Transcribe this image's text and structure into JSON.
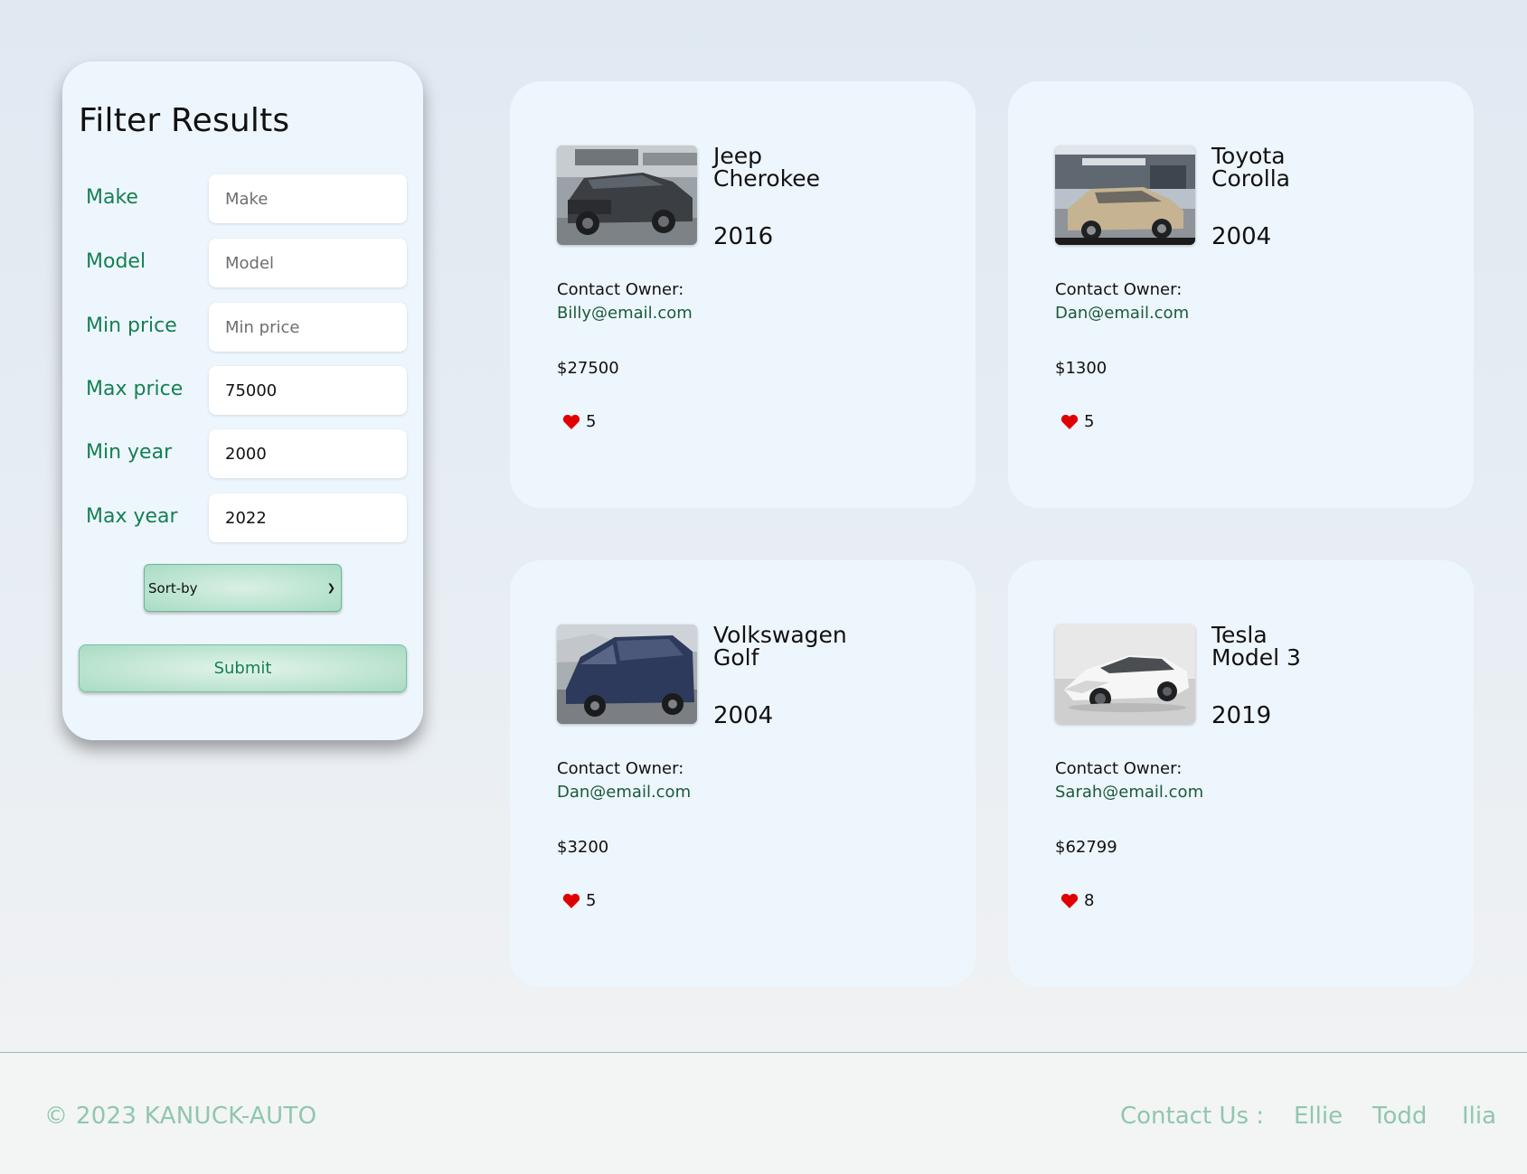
{
  "filter": {
    "title": "Filter Results",
    "fields": [
      {
        "label": "Make",
        "placeholder": "Make",
        "value": ""
      },
      {
        "label": "Model",
        "placeholder": "Model",
        "value": ""
      },
      {
        "label": "Min price",
        "placeholder": "Min price",
        "value": ""
      },
      {
        "label": "Max price",
        "placeholder": "Max price",
        "value": "75000"
      },
      {
        "label": "Min year",
        "placeholder": "Min year",
        "value": "2000"
      },
      {
        "label": "Max year",
        "placeholder": "Max year",
        "value": "2022"
      }
    ],
    "sort_selected": "Sort-by",
    "submit_label": "Submit"
  },
  "listings": [
    {
      "make": "Jeep",
      "model": "Cherokee",
      "year": "2016",
      "contact_label": "Contact Owner:",
      "email": "Billy@email.com",
      "price": "$27500",
      "likes": "5"
    },
    {
      "make": "Toyota",
      "model": "Corolla",
      "year": "2004",
      "contact_label": "Contact Owner:",
      "email": "Dan@email.com",
      "price": "$1300",
      "likes": "5"
    },
    {
      "make": "Volkswagen",
      "model": "Golf",
      "year": "2004",
      "contact_label": "Contact Owner:",
      "email": "Dan@email.com",
      "price": "$3200",
      "likes": "5"
    },
    {
      "make": "Tesla",
      "model": "Model 3",
      "year": "2019",
      "contact_label": "Contact Owner:",
      "email": "Sarah@email.com",
      "price": "$62799",
      "likes": "8"
    }
  ],
  "footer": {
    "copyright": "© 2023 KANUCK-AUTO",
    "contact_label": "Contact Us :",
    "contacts": [
      "Ellie",
      "Todd",
      "Ilia"
    ]
  },
  "colors": {
    "accent_green": "#148050",
    "footer_text": "#8fc7ae",
    "heart": "#e00000",
    "card_bg": "#eef6fd"
  }
}
